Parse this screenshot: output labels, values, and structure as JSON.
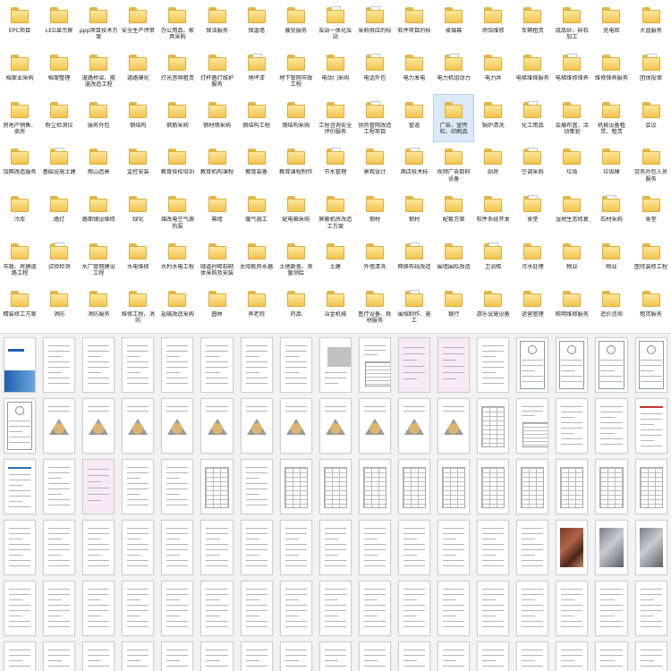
{
  "folders": [
    {
      "label": "EPC项目"
    },
    {
      "label": "LED显示屏"
    },
    {
      "label": "ppp项目技术方案"
    },
    {
      "label": "安全生产评审"
    },
    {
      "label": "办公用品、家具采购"
    },
    {
      "label": "保洁服务"
    },
    {
      "label": "保温墙"
    },
    {
      "label": "展览服务"
    },
    {
      "label": "泵站一体化泵站"
    },
    {
      "label": "采购供应的标"
    },
    {
      "label": "软件项目的标"
    },
    {
      "label": "玻璃幕"
    },
    {
      "label": "场馆维修"
    },
    {
      "label": "车辆租赁"
    },
    {
      "label": "成品砂、碎石加工"
    },
    {
      "label": "充电桩"
    },
    {
      "label": "大直服务"
    },
    {
      "label": "档案业采购"
    },
    {
      "label": "档案整理"
    },
    {
      "label": "道路桥梁、隧道改造工程"
    },
    {
      "label": "道路硬化"
    },
    {
      "label": "灯光音响租赁"
    },
    {
      "label": "灯杆路灯维护服务"
    },
    {
      "label": "地坪漆"
    },
    {
      "label": "地下管网市政工程"
    },
    {
      "label": "电动门采购"
    },
    {
      "label": "电话外包"
    },
    {
      "label": "电力发电"
    },
    {
      "label": "电力机组动力"
    },
    {
      "label": "电力井"
    },
    {
      "label": "电梯维保服务"
    },
    {
      "label": "电梯维修保养"
    },
    {
      "label": "维修保养服务"
    },
    {
      "label": "团体投保"
    },
    {
      "label": "房地产销售、卖房"
    },
    {
      "label": "粉尘检测仪"
    },
    {
      "label": "服务外包"
    },
    {
      "label": "钢结构"
    },
    {
      "label": "钢筋采购"
    },
    {
      "label": "钢材钢采购"
    },
    {
      "label": "钢结构工程"
    },
    {
      "label": "钢结构采购"
    },
    {
      "label": "工程咨询安全评价服务"
    },
    {
      "label": "供热管网改造工程项目"
    },
    {
      "label": "管道"
    },
    {
      "label": "广告、宣传栏、印刷品"
    },
    {
      "label": "锅炉清洗"
    },
    {
      "label": "化工用品"
    },
    {
      "label": "会展布置、活动策划"
    },
    {
      "label": "机械设备租赁、租赁"
    },
    {
      "label": "会议"
    },
    {
      "label": "加固改造服务"
    },
    {
      "label": "基础设施土建"
    },
    {
      "label": "假山造景"
    },
    {
      "label": "监控安装"
    },
    {
      "label": "教育技校培训"
    },
    {
      "label": "教育机构课程"
    },
    {
      "label": "教育装备"
    },
    {
      "label": "教育课程制作"
    },
    {
      "label": "节水管理"
    },
    {
      "label": "景观设计"
    },
    {
      "label": "酒店技术标"
    },
    {
      "label": "视频广告数码设备"
    },
    {
      "label": "厨房"
    },
    {
      "label": "空调采购"
    },
    {
      "label": "垃圾"
    },
    {
      "label": "垃圾桶"
    },
    {
      "label": "劳务外包人员服务"
    },
    {
      "label": "冷库"
    },
    {
      "label": "路灯"
    },
    {
      "label": "路面铺设维修"
    },
    {
      "label": "绿化"
    },
    {
      "label": "煤改电空气源热泵"
    },
    {
      "label": "幕墙"
    },
    {
      "label": "暖气施工"
    },
    {
      "label": "配电箱采购"
    },
    {
      "label": "屏蔽机房改造工方案"
    },
    {
      "label": "钢材"
    },
    {
      "label": "钢材"
    },
    {
      "label": "配套方案"
    },
    {
      "label": "软件系统开发"
    },
    {
      "label": "食堂"
    },
    {
      "label": "湿地生态修复"
    },
    {
      "label": "石材采购"
    },
    {
      "label": "食堂"
    },
    {
      "label": "市政、房建道路工程"
    },
    {
      "label": "试验检测"
    },
    {
      "label": "水厂管网建设工程"
    },
    {
      "label": "水电维修"
    },
    {
      "label": "水利水电工程"
    },
    {
      "label": "隧道衬砌石砌体采购及安装"
    },
    {
      "label": "太阳能热水器"
    },
    {
      "label": "土地勘查、测量测绘"
    },
    {
      "label": "土建"
    },
    {
      "label": "外墙清洗"
    },
    {
      "label": "网络布线改造"
    },
    {
      "label": "围墙围栏改造"
    },
    {
      "label": "卫浴柜"
    },
    {
      "label": "污水处理"
    },
    {
      "label": "物业"
    },
    {
      "label": "物业"
    },
    {
      "label": "医院装修工程"
    },
    {
      "label": "精装修工方案"
    },
    {
      "label": "消防"
    },
    {
      "label": "消防服务"
    },
    {
      "label": "维修工程、消防"
    },
    {
      "label": "盐碱改造采购"
    },
    {
      "label": "园林"
    },
    {
      "label": "养老院"
    },
    {
      "label": "药品"
    },
    {
      "label": "冶金机械"
    },
    {
      "label": "医疗设备、耗材服务"
    },
    {
      "label": "围挡制作、施工"
    },
    {
      "label": "银行"
    },
    {
      "label": "游乐设施设备"
    },
    {
      "label": "运营管理"
    },
    {
      "label": "照明维修服务"
    },
    {
      "label": "造价咨询"
    },
    {
      "label": "租赁服务"
    }
  ],
  "selected_folder_index": 45,
  "thumbnail_rows": [
    [
      "cover-blue",
      "text",
      "text",
      "text",
      "text",
      "text",
      "text",
      "text",
      "stamp",
      "form",
      "pink",
      "pink",
      "text",
      "cert",
      "cert",
      "cert",
      "cert"
    ],
    [
      "cert",
      "tri",
      "tri",
      "tri",
      "tri",
      "tri",
      "tri",
      "tri",
      "tri",
      "tri",
      "tri",
      "tri",
      "table",
      "form",
      "text",
      "text",
      "red-text"
    ],
    [
      "blue-text",
      "text",
      "pink",
      "text",
      "text",
      "table",
      "text",
      "table",
      "table",
      "table",
      "table",
      "table",
      "table",
      "table",
      "table",
      "table",
      "table"
    ],
    [
      "text",
      "text",
      "text",
      "text",
      "text",
      "text",
      "text",
      "text",
      "text",
      "text",
      "text",
      "text",
      "text",
      "text",
      "photo",
      "photo2",
      "photo2"
    ],
    [
      "text",
      "text",
      "text",
      "text",
      "text",
      "text",
      "text",
      "text",
      "text",
      "text",
      "text",
      "text",
      "text",
      "text",
      "text",
      "text",
      "text"
    ],
    [
      "text",
      "text",
      "text",
      "text",
      "text",
      "text",
      "text",
      "text",
      "text",
      "text",
      "text",
      "text",
      "text",
      "text",
      "text",
      "text",
      "text"
    ]
  ]
}
